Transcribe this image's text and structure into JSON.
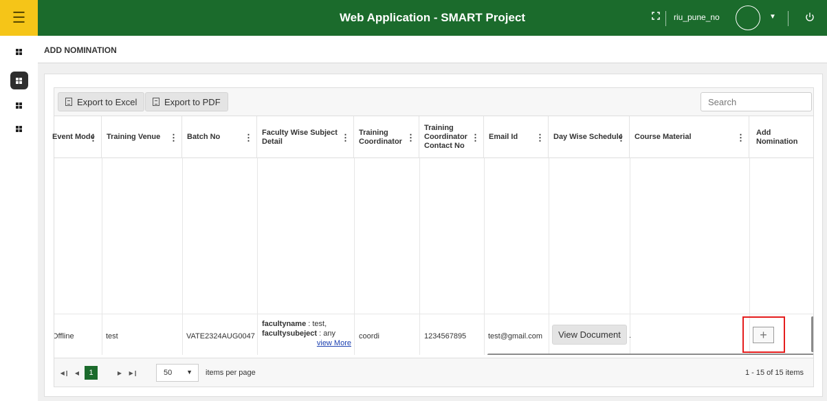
{
  "app": {
    "title": "Web Application - SMART Project",
    "username": "riu_pune_no"
  },
  "page": {
    "title": "ADD NOMINATION"
  },
  "toolbar": {
    "export_excel": "Export to Excel",
    "export_pdf": "Export to PDF",
    "search_placeholder": "Search"
  },
  "columns": [
    {
      "label": "Event Mode"
    },
    {
      "label": "Training Venue"
    },
    {
      "label": "Batch No"
    },
    {
      "label": "Faculty Wise Subject Detail"
    },
    {
      "label": "Training Coordinator"
    },
    {
      "label": "Training Coordinator Contact No"
    },
    {
      "label": "Email Id"
    },
    {
      "label": "Day Wise Schedule"
    },
    {
      "label": "Course Material"
    },
    {
      "label": "Add Nomination"
    }
  ],
  "row": {
    "event_mode": "Offline",
    "venue": "test",
    "batch_no": "VATE2324AUG0047",
    "faculty_name_key": "facultyname",
    "faculty_name_val": " : test,",
    "faculty_subject_key": "facultysubeject",
    "faculty_subject_val": ": any",
    "view_more": "view More",
    "coordinator": "coordi",
    "contact": "1234567895",
    "email": "test@gmail.com",
    "schedule_btn": "View Document",
    "schedule_trail": "."
  },
  "pager": {
    "current_page": "1",
    "page_size": "50",
    "per_page_label": "items per page",
    "range": "1 - 15 of 15 items"
  },
  "colors": {
    "header_green": "#1b6b2c",
    "hamburger_yellow": "#f5c518",
    "highlight_red": "#e41b1b"
  }
}
